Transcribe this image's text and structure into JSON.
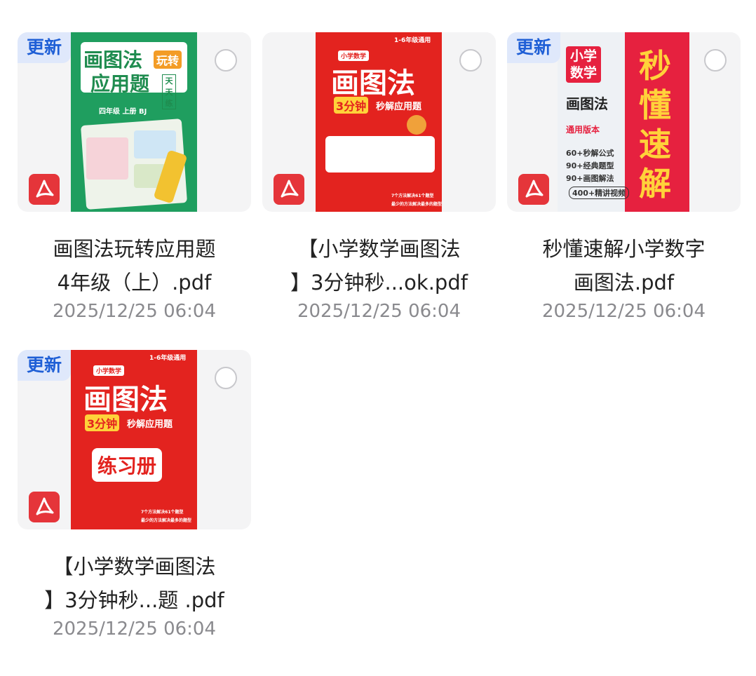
{
  "files": [
    {
      "badge": "更新",
      "name_lines": [
        "画图法玩转应用题",
        "4年级（上）.pdf"
      ],
      "date": "2025/12/25 06:04",
      "cover": {
        "title1": "画图法",
        "tag": "玩转",
        "title2": "应用题",
        "side": "天天练",
        "grade": "四年级 上册 BJ"
      }
    },
    {
      "badge": "",
      "name_lines": [
        "【小学数学画图法",
        "】3分钟秒...ok.pdf"
      ],
      "date": "2025/12/25 06:04",
      "cover": {
        "top": "1-6年级通用",
        "sub": "小学数学",
        "title": "画图法",
        "min": "3分钟",
        "tail": "秒解应用题",
        "tip1": "7个方法解决61个题型",
        "tip2": "最少的方法解决最多的题型"
      }
    },
    {
      "badge": "更新",
      "name_lines": [
        "秒懂速解小学数字",
        "画图法.pdf"
      ],
      "date": "2025/12/25 06:04",
      "cover": {
        "box": "小学数学",
        "title": "画图法",
        "big": "秒懂速解",
        "edition": "通用版本",
        "l1": "60+秒解公式",
        "l2": "90+经典题型",
        "l3": "90+画图解法",
        "l4": "400+精讲视频"
      }
    },
    {
      "badge": "更新",
      "name_lines": [
        "【小学数学画图法",
        "】3分钟秒...题 .pdf"
      ],
      "date": "2025/12/25 06:04",
      "cover": {
        "top": "1-6年级通用",
        "sub": "小学数学",
        "title": "画图法",
        "min": "3分钟",
        "tail": "秒解应用题",
        "book": "练习册",
        "tip1": "7个方法解决61个题型",
        "tip2": "最少的方法解决最多的题型"
      }
    }
  ],
  "icons": {
    "file_type": "pdf-icon",
    "select": "select-circle-icon"
  },
  "colors": {
    "badge_bg": "#dfe8fb",
    "badge_text": "#1f5fd6",
    "pdf_red": "#e5353a",
    "date_gray": "#8a8a8e"
  }
}
